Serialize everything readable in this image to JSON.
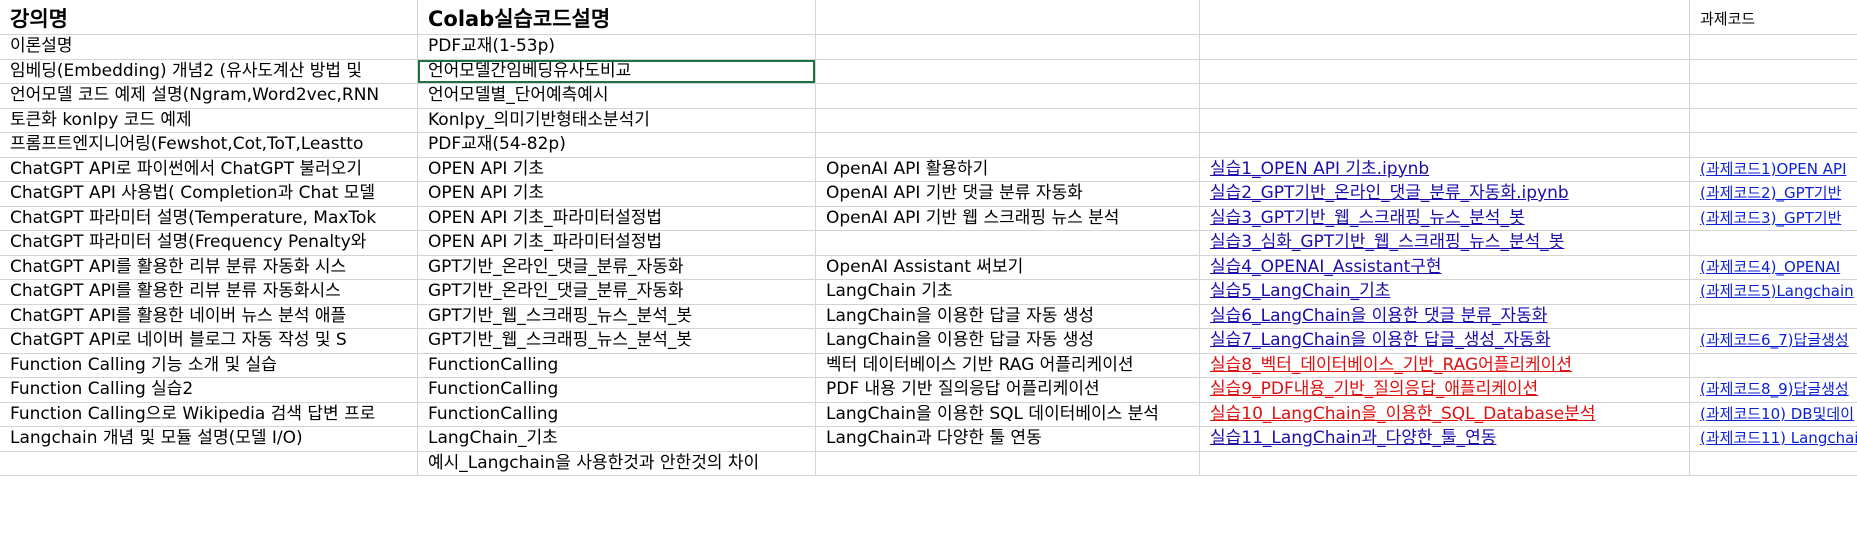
{
  "header": {
    "col_a": "강의명",
    "col_b": "Colab실습코드설명",
    "col_e": "과제코드"
  },
  "rows": [
    {
      "a": "이론설명",
      "b": "PDF교재(1-53p)",
      "c": "",
      "d": "",
      "e": ""
    },
    {
      "a": "임베딩(Embedding) 개념2 (유사도계산 방법 및",
      "b": "언어모델간임베딩유사도비교",
      "c": "",
      "d": "",
      "e": ""
    },
    {
      "a": "언어모델 코드 예제 설명(Ngram,Word2vec,RNN",
      "b": "언어모델별_단어예측예시",
      "c": "",
      "d": "",
      "e": ""
    },
    {
      "a": "토큰화 konlpy 코드 예제",
      "b": "Konlpy_의미기반형태소분석기",
      "c": "",
      "d": "",
      "e": ""
    },
    {
      "a": "프롬프트엔지니어링(Fewshot,Cot,ToT,Leastto",
      "b": "PDF교재(54-82p)",
      "c": "",
      "d": "",
      "e": ""
    },
    {
      "a": "ChatGPT API로 파이썬에서 ChatGPT 불러오기",
      "b": "OPEN API 기초",
      "c": "OpenAI API 활용하기",
      "d": "실습1_OPEN API 기초.ipynb",
      "e": "(과제코드1)OPEN API"
    },
    {
      "a": "ChatGPT API 사용법( Completion과 Chat 모델",
      "b": "OPEN API 기초",
      "c": "OpenAI API 기반 댓글 분류 자동화",
      "d": "실습2_GPT기반_온라인_댓글_분류_자동화.ipynb",
      "e": "(과제코드2)_GPT기반"
    },
    {
      "a": "ChatGPT 파라미터 설명(Temperature, MaxTok",
      "b": "OPEN API 기초_파라미터설정법",
      "c": "OpenAI API 기반 웹 스크래핑 뉴스 분석",
      "d": "실습3_GPT기반_웹_스크래핑_뉴스_분석_봇",
      "e": "(과제코드3)_GPT기반"
    },
    {
      "a": "ChatGPT 파라미터 설명(Frequency Penalty와",
      "b": "OPEN API 기초_파라미터설정법",
      "c": "",
      "d": "실습3_심화_GPT기반_웹_스크래핑_뉴스_분석_봇",
      "e": ""
    },
    {
      "a": "ChatGPT API를 활용한 리뷰 분류 자동화 시스",
      "b": "GPT기반_온라인_댓글_분류_자동화",
      "c": "OpenAI Assistant 써보기",
      "d": "실습4_OPENAI_Assistant구현",
      "e": "(과제코드4)_OPENAI"
    },
    {
      "a": "ChatGPT API를 활용한 리뷰 분류 자동화시스",
      "b": "GPT기반_온라인_댓글_분류_자동화",
      "c": "LangChain 기초",
      "d": "실습5_LangChain_기초",
      "e": "(과제코드5)Langchain"
    },
    {
      "a": "ChatGPT API를 활용한 네이버 뉴스 분석 애플",
      "b": "GPT기반_웹_스크래핑_뉴스_분석_봇",
      "c": "LangChain을 이용한 답글 자동 생성",
      "d": "실습6_LangChain을 이용한 댓글 분류_자동화",
      "e": ""
    },
    {
      "a": "ChatGPT API로 네이버 블로그 자동 작성 및 S",
      "b": "GPT기반_웹_스크래핑_뉴스_분석_봇",
      "c": "LangChain을 이용한 답글 자동 생성",
      "d": "실습7_LangChain을 이용한 답글_생성_자동화",
      "e": "(과제코드6_7)답글생성"
    },
    {
      "a": "Function Calling 기능 소개 및 실습",
      "b": "FunctionCalling",
      "c": "벡터 데이터베이스 기반 RAG 어플리케이션",
      "d": "실습8_벡터_데이터베이스_기반_RAG어플리케이션",
      "e": ""
    },
    {
      "a": "Function Calling 실습2",
      "b": "FunctionCalling",
      "c": "PDF 내용 기반 질의응답 어플리케이션",
      "d": "실습9_PDF내용_기반_질의응답_애플리케이션",
      "e": "(과제코드8_9)답글생성"
    },
    {
      "a": "Function Calling으로 Wikipedia 검색 답변 프로",
      "b": "FunctionCalling",
      "c": "LangChain을 이용한 SQL 데이터베이스 분석",
      "d": "실습10_LangChain을_이용한_SQL_Database분석",
      "e": "(과제코드10) DB및데이"
    },
    {
      "a": "Langchain 개념 및 모듈 설명(모델 I/O)",
      "b": "LangChain_기초",
      "c": "LangChain과 다양한 툴 연동",
      "d": "실습11_LangChain과_다양한_툴_연동",
      "e": "(과제코드11) Langchain"
    },
    {
      "a": "",
      "b": "예시_Langchain을 사용한것과 안한것의 차이",
      "c": "",
      "d": "",
      "e": ""
    }
  ],
  "colors": {
    "link_blue": "#1a0dab",
    "link_red": "#e01010",
    "selection": "#1e7145",
    "gridline": "#d4d4d4"
  }
}
